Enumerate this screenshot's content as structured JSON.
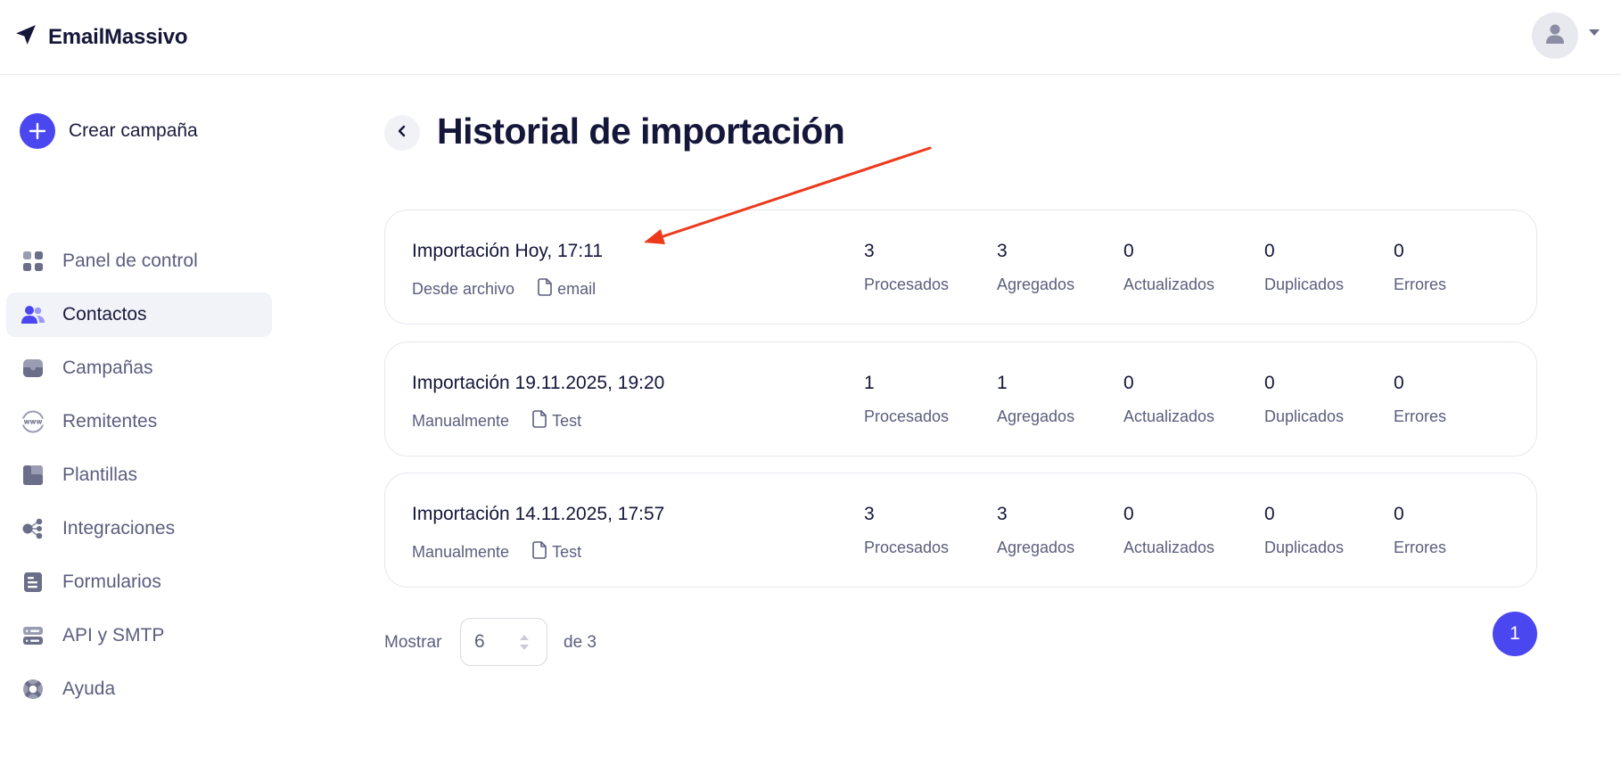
{
  "app": {
    "name": "EmailMassivo"
  },
  "colors": {
    "accent": "#4b47f0",
    "annotation_arrow": "#ec3a1c"
  },
  "sidebar": {
    "create_label": "Crear campaña",
    "items": [
      {
        "label": "Panel de control",
        "icon": "grid-icon",
        "active": false
      },
      {
        "label": "Contactos",
        "icon": "users-icon",
        "active": true
      },
      {
        "label": "Campañas",
        "icon": "inbox-icon",
        "active": false
      },
      {
        "label": "Remitentes",
        "icon": "www-globe-icon",
        "active": false
      },
      {
        "label": "Plantillas",
        "icon": "templates-icon",
        "active": false
      },
      {
        "label": "Integraciones",
        "icon": "integrations-icon",
        "active": false
      },
      {
        "label": "Formularios",
        "icon": "form-icon",
        "active": false
      },
      {
        "label": "API y SMTP",
        "icon": "server-icon",
        "active": false
      },
      {
        "label": "Ayuda",
        "icon": "lifebuoy-icon",
        "active": false
      }
    ]
  },
  "page": {
    "title": "Historial de importación"
  },
  "imports": [
    {
      "title": "Importación Hoy, 17:11",
      "source": "Desde archivo",
      "file": "email",
      "stats": [
        {
          "value": "3",
          "label": "Procesados"
        },
        {
          "value": "3",
          "label": "Agregados"
        },
        {
          "value": "0",
          "label": "Actualizados"
        },
        {
          "value": "0",
          "label": "Duplicados"
        },
        {
          "value": "0",
          "label": "Errores"
        }
      ]
    },
    {
      "title": "Importación 19.11.2025, 19:20",
      "source": "Manualmente",
      "file": "Test",
      "stats": [
        {
          "value": "1",
          "label": "Procesados"
        },
        {
          "value": "1",
          "label": "Agregados"
        },
        {
          "value": "0",
          "label": "Actualizados"
        },
        {
          "value": "0",
          "label": "Duplicados"
        },
        {
          "value": "0",
          "label": "Errores"
        }
      ]
    },
    {
      "title": "Importación 14.11.2025, 17:57",
      "source": "Manualmente",
      "file": "Test",
      "stats": [
        {
          "value": "3",
          "label": "Procesados"
        },
        {
          "value": "3",
          "label": "Agregados"
        },
        {
          "value": "0",
          "label": "Actualizados"
        },
        {
          "value": "0",
          "label": "Duplicados"
        },
        {
          "value": "0",
          "label": "Errores"
        }
      ]
    }
  ],
  "pagination": {
    "show_label": "Mostrar",
    "per_page": "6",
    "of_label": "de 3",
    "current_page": "1"
  }
}
